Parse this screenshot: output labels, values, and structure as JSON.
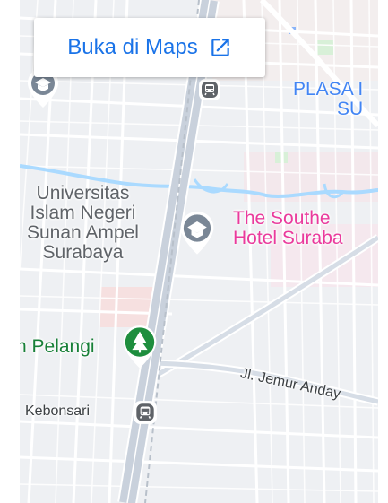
{
  "open_in_maps": {
    "label": "Buka di Maps",
    "icon": "external-link-icon"
  },
  "places": {
    "university": [
      "Universitas",
      "Islam Negeri",
      "Sunan Ampel",
      "Surabaya"
    ],
    "hotel": [
      "The Southe",
      "Hotel Suraba"
    ],
    "mall": [
      "PLASA I",
      "SU"
    ],
    "park": "n Pelangi",
    "station": "Kebonsari"
  },
  "roads": {
    "jemur": "Jl. Jemur Anday"
  },
  "colors": {
    "link": "#1a73e8",
    "hotel_label": "#ea3a9c",
    "mall_label": "#4285f4",
    "park_label": "#188038",
    "edu_pin": "#7a8796",
    "park_pin": "#1e8e3e",
    "water": "#aadaff",
    "road_major": "#c9d1dc"
  }
}
